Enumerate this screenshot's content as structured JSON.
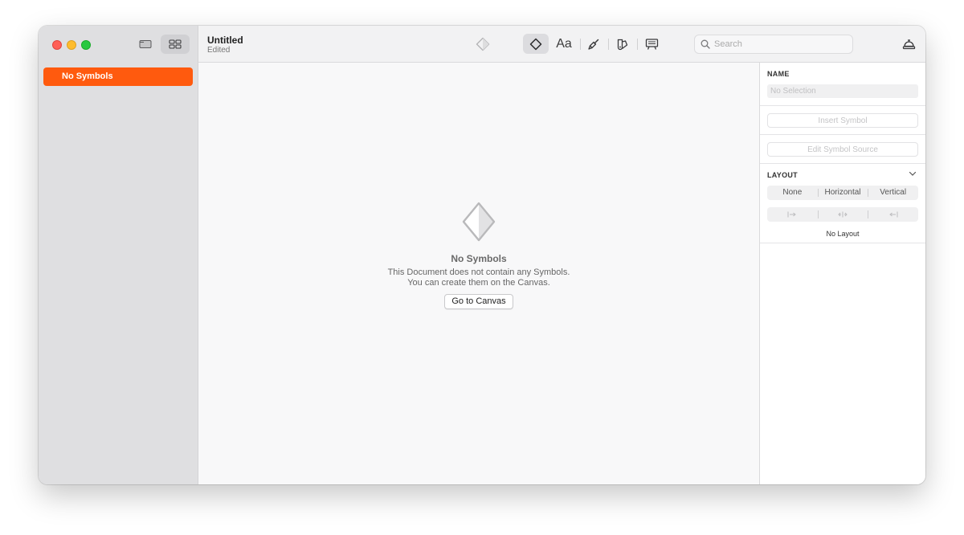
{
  "sidebar": {
    "items": [
      {
        "label": "No Symbols",
        "selected": true
      }
    ]
  },
  "toolbar": {
    "document_title": "Untitled",
    "document_status": "Edited",
    "text_tool_label": "Aa",
    "search_placeholder": "Search"
  },
  "canvas": {
    "empty_title": "No Symbols",
    "empty_line1": "This Document does not contain any Symbols.",
    "empty_line2": "You can create them on the Canvas.",
    "goto_button": "Go to Canvas"
  },
  "inspector": {
    "name_label": "NAME",
    "name_placeholder": "No Selection",
    "insert_symbol": "Insert Symbol",
    "edit_symbol_source": "Edit Symbol Source",
    "layout_label": "LAYOUT",
    "layout_options": [
      "None",
      "Horizontal",
      "Vertical"
    ],
    "no_layout": "No Layout"
  },
  "colors": {
    "accent": "#ff5a0e",
    "sidebar_bg": "#dfdfe1",
    "canvas_bg": "#f8f8f9",
    "toolbar_bg": "#f2f2f3"
  }
}
